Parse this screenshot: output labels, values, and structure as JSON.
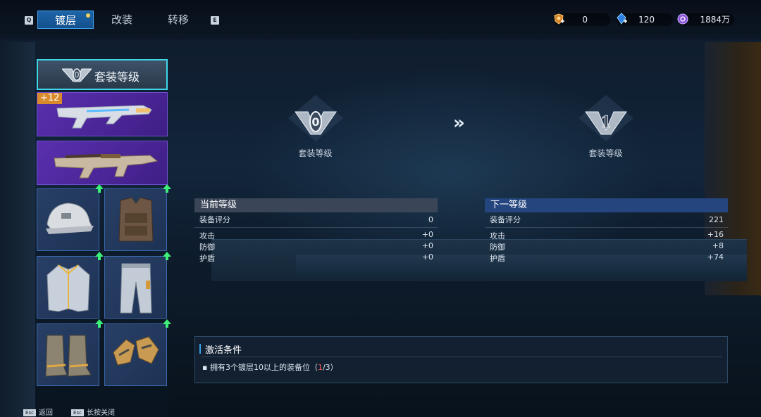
{
  "topbar": {
    "key_left": "Q",
    "key_right": "E",
    "tabs": [
      {
        "label": "镀层",
        "active": true,
        "has_dot": true
      },
      {
        "label": "改装",
        "active": false
      },
      {
        "label": "转移",
        "active": false
      }
    ],
    "currencies": [
      {
        "icon": "gold-crest-icon",
        "value": "0"
      },
      {
        "icon": "blue-crystal-icon",
        "value": "120"
      },
      {
        "icon": "purple-coin-icon",
        "value": "1884万"
      }
    ]
  },
  "left_panel": {
    "set_header_label": "套装等级",
    "set_header_level": "0",
    "weapons": [
      {
        "name": "primary-rifle",
        "plus": "+12"
      },
      {
        "name": "secondary-smg",
        "plus": ""
      }
    ],
    "gear": [
      {
        "name": "helmet",
        "icon": "helmet-icon",
        "upgradable": true
      },
      {
        "name": "backpack-vest",
        "icon": "tactical-vest-icon",
        "upgradable": true
      },
      {
        "name": "jacket",
        "icon": "jacket-icon",
        "upgradable": true
      },
      {
        "name": "pants",
        "icon": "pants-icon",
        "upgradable": true
      },
      {
        "name": "boots",
        "icon": "boots-icon",
        "upgradable": true
      },
      {
        "name": "gloves",
        "icon": "gloves-icon",
        "upgradable": true
      }
    ]
  },
  "level_compare": {
    "current": {
      "level": "0",
      "caption": "套装等级"
    },
    "next": {
      "level": "1",
      "caption": "套装等级"
    },
    "arrow": "»"
  },
  "current_stats": {
    "header": "当前等级",
    "score_label": "装备评分",
    "score": "0",
    "rows": [
      {
        "label": "攻击",
        "value": "+0"
      },
      {
        "label": "防御",
        "value": "+0"
      },
      {
        "label": "护盾",
        "value": "+0"
      }
    ]
  },
  "next_stats": {
    "header": "下一等级",
    "score_label": "装备评分",
    "score": "221",
    "rows": [
      {
        "label": "攻击",
        "value": "+16"
      },
      {
        "label": "防御",
        "value": "+8"
      },
      {
        "label": "护盾",
        "value": "+74"
      }
    ]
  },
  "activation": {
    "title": "激活条件",
    "condition_prefix": "拥有3个镀层10以上的装备位（",
    "condition_current": "1",
    "condition_suffix": "/3）"
  },
  "footer": [
    {
      "key": "Esc",
      "label": "返回"
    },
    {
      "key": "Esc",
      "label": "长按关闭"
    }
  ],
  "colors": {
    "accent": "#3fd7e8",
    "tab_active": "#1c64a8",
    "weapon_slot": "#5a2fae",
    "gear_slot": "#283f66",
    "upgrade_arrow": "#3df07a",
    "warning": "#ff5a5a"
  }
}
